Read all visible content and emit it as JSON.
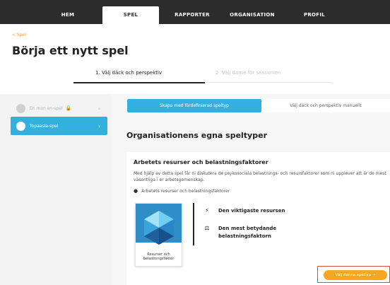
{
  "nav": {
    "items": [
      {
        "label": "HEM"
      },
      {
        "label": "SPEL"
      },
      {
        "label": "RAPPORTER"
      },
      {
        "label": "ORGANISATION"
      },
      {
        "label": "PROFIL"
      }
    ],
    "active_index": 1
  },
  "breadcrumb": {
    "back_label": "< Spel"
  },
  "page": {
    "title": "Börja ett nytt spel"
  },
  "steps": [
    {
      "label": "1. Välj däck och perspektiv",
      "state": "active"
    },
    {
      "label": "2. Välj dame för sessionen",
      "state": "inactive"
    }
  ],
  "sidebar": {
    "items": [
      {
        "label": "En mon en-spel",
        "icon": "game-icon",
        "locked": true,
        "state": "disabled"
      },
      {
        "label": "Topaasia-spel",
        "icon": "topaasia-logo-icon",
        "locked": false,
        "state": "active"
      }
    ]
  },
  "tabs": [
    {
      "label": "Skapa med fördefinierad speltyp",
      "active": true
    },
    {
      "label": "Välj däck och perspektiv manuellt",
      "active": false
    }
  ],
  "section": {
    "title": "Organisationens egna speltyper"
  },
  "card": {
    "title": "Arbetets resurser och belastningsfaktorer",
    "description": "Med hjälp av detta spel får ni diskutera de psykosociala belastnings- och resursfaktorer som ni upplever att är de mest väsentliga i er arbetsgemenskap.",
    "bullet": "Arbetets resurser och belastningsfaktorer",
    "tile_caption": "Resurser och belastningsfaktor",
    "features": [
      {
        "icon": "lightning-icon",
        "label": "Den viktigaste resursen"
      },
      {
        "icon": "weight-icon",
        "label": "Den mest betydande belastningsfaktorn"
      }
    ],
    "cta_label": "Välj denna speltyp →"
  },
  "colors": {
    "nav_bg": "#2c2c2c",
    "accent_blue": "#33b0e0",
    "accent_orange": "#f5a623",
    "highlight_red": "#e04b3a"
  }
}
